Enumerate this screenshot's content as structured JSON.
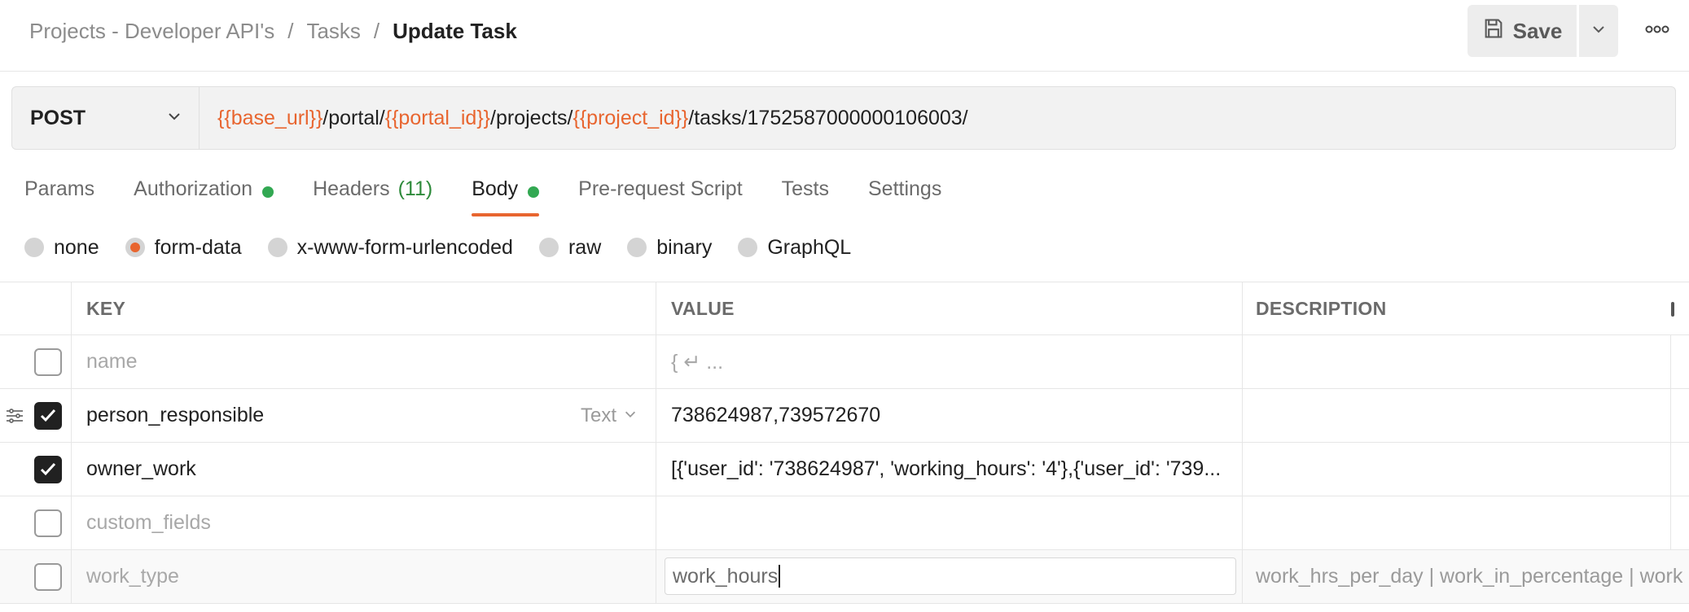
{
  "breadcrumb": {
    "items": [
      "Projects - Developer API's",
      "Tasks"
    ],
    "separator": "/",
    "current": "Update Task"
  },
  "toolbar": {
    "save_label": "Save"
  },
  "request": {
    "method": "POST",
    "url_parts": [
      {
        "text": "{{base_url}}",
        "var": true
      },
      {
        "text": "/portal/",
        "var": false
      },
      {
        "text": "{{portal_id}}",
        "var": true
      },
      {
        "text": "/projects/",
        "var": false
      },
      {
        "text": "{{project_id}}",
        "var": true
      },
      {
        "text": "/tasks/1752587000000106003/",
        "var": false
      }
    ]
  },
  "tabs": {
    "params": "Params",
    "authorization": "Authorization",
    "headers": "Headers",
    "headers_count": "(11)",
    "body": "Body",
    "prerequest": "Pre-request Script",
    "tests": "Tests",
    "settings": "Settings",
    "active": "Body"
  },
  "body_types": {
    "none": "none",
    "form_data": "form-data",
    "urlencoded": "x-www-form-urlencoded",
    "raw": "raw",
    "binary": "binary",
    "graphql": "GraphQL",
    "selected": "form-data"
  },
  "table": {
    "headers": {
      "key": "KEY",
      "value": "VALUE",
      "description": "DESCRIPTION"
    },
    "rows": [
      {
        "checked": false,
        "key": "name",
        "key_placeholder": true,
        "value": "{ ↵ ...",
        "value_placeholder": true,
        "type": "",
        "description": ""
      },
      {
        "checked": true,
        "key": "person_responsible",
        "key_placeholder": false,
        "value": "738624987,739572670",
        "value_placeholder": false,
        "type": "Text",
        "description": ""
      },
      {
        "checked": true,
        "key": "owner_work",
        "key_placeholder": false,
        "value": "[{'user_id': '738624987', 'working_hours': '4'},{'user_id': '739...",
        "value_placeholder": false,
        "type": "",
        "description": ""
      },
      {
        "checked": false,
        "key": "custom_fields",
        "key_placeholder": true,
        "value": "",
        "value_placeholder": false,
        "type": "",
        "description": ""
      },
      {
        "checked": false,
        "key": "work_type",
        "key_placeholder": true,
        "value": "work_hours",
        "value_placeholder": false,
        "type": "",
        "description": "work_hrs_per_day | work_in_percentage | work"
      }
    ]
  },
  "colors": {
    "accent": "#e8652f",
    "status_ok": "#32a852",
    "count_green": "#2d8a3a"
  }
}
